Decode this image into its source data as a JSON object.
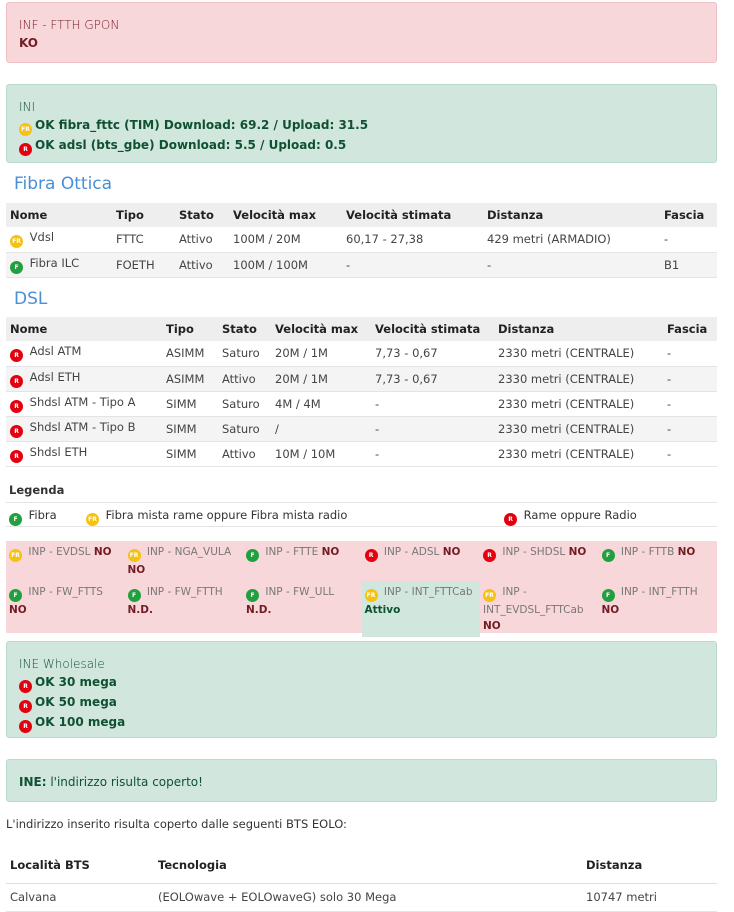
{
  "inf": {
    "title": "INF - FTTH GPON",
    "status": "KO"
  },
  "ini": {
    "title": "INI",
    "lines": [
      {
        "badge": "FR",
        "text": "OK fibra_fttc (TIM) Download: 69.2 / Upload: 31.5"
      },
      {
        "badge": "R",
        "text": "OK adsl (bts_gbe) Download: 5.5 / Upload: 0.5"
      }
    ]
  },
  "fibra": {
    "title": "Fibra Ottica",
    "headers": [
      "Nome",
      "Tipo",
      "Stato",
      "Velocità max",
      "Velocità stimata",
      "Distanza",
      "Fascia"
    ],
    "rows": [
      [
        "FR",
        "Vdsl",
        "FTTC",
        "Attivo",
        "100M / 20M",
        "60,17 - 27,38",
        "429 metri (ARMADIO)",
        "-"
      ],
      [
        "F",
        "Fibra ILC",
        "FOETH",
        "Attivo",
        "100M / 100M",
        "-",
        "-",
        "B1"
      ]
    ]
  },
  "dsl": {
    "title": "DSL",
    "headers": [
      "Nome",
      "Tipo",
      "Stato",
      "Velocità max",
      "Velocità stimata",
      "Distanza",
      "Fascia"
    ],
    "rows": [
      [
        "R",
        "Adsl ATM",
        "ASIMM",
        "Saturo",
        "20M / 1M",
        "7,73 - 0,67",
        "2330 metri (CENTRALE)",
        "-"
      ],
      [
        "R",
        "Adsl ETH",
        "ASIMM",
        "Attivo",
        "20M / 1M",
        "7,73 - 0,67",
        "2330 metri (CENTRALE)",
        "-"
      ],
      [
        "R",
        "Shdsl ATM - Tipo A",
        "SIMM",
        "Saturo",
        "4M / 4M",
        "-",
        "2330 metri (CENTRALE)",
        "-"
      ],
      [
        "R",
        "Shdsl ATM - Tipo B",
        "SIMM",
        "Saturo",
        "/",
        "-",
        "2330 metri (CENTRALE)",
        "-"
      ],
      [
        "R",
        "Shdsl ETH",
        "SIMM",
        "Attivo",
        "10M / 10M",
        "-",
        "2330 metri (CENTRALE)",
        "-"
      ]
    ]
  },
  "legend": {
    "title": "Legenda",
    "items": [
      {
        "badge": "F",
        "label": "Fibra"
      },
      {
        "badge": "FR",
        "label": "Fibra mista rame oppure Fibra mista radio"
      },
      {
        "badge": "R",
        "label": "Rame oppure Radio"
      }
    ]
  },
  "inp": [
    {
      "badge": "FR",
      "label": "INP - EVDSL",
      "value": "NO"
    },
    {
      "badge": "FR",
      "label": "INP - NGA_VULA",
      "value": "NO"
    },
    {
      "badge": "F",
      "label": "INP - FTTE",
      "value": "NO"
    },
    {
      "badge": "R",
      "label": "INP - ADSL",
      "value": "NO"
    },
    {
      "badge": "R",
      "label": "INP - SHDSL",
      "value": "NO"
    },
    {
      "badge": "F",
      "label": "INP - FTTB",
      "value": "NO"
    },
    {
      "badge": "F",
      "label": "INP - FW_FTTS",
      "value": "NO"
    },
    {
      "badge": "F",
      "label": "INP - FW_FTTH",
      "value": "N.D."
    },
    {
      "badge": "F",
      "label": "INP - FW_ULL",
      "value": "N.D."
    },
    {
      "badge": "FR",
      "label": "INP - INT_FTTCab",
      "value": "Attivo",
      "ok": true
    },
    {
      "badge": "FR",
      "label": "INP - INT_EVDSL_FTTCab",
      "value": "NO"
    },
    {
      "badge": "F",
      "label": "INP - INT_FTTH",
      "value": "NO"
    }
  ],
  "ine": {
    "title": "INE Wholesale",
    "lines": [
      {
        "badge": "R",
        "text": "OK 30 mega"
      },
      {
        "badge": "R",
        "text": "OK 50 mega"
      },
      {
        "badge": "R",
        "text": "OK 100 mega"
      }
    ]
  },
  "ine_note": {
    "label": "INE:",
    "text": " l'indirizzo risulta coperto!"
  },
  "bts": {
    "intro": "L'indirizzo inserito risulta coperto dalle seguenti BTS EOLO:",
    "headers": [
      "Località BTS",
      "Tecnologia",
      "Distanza"
    ],
    "rows": [
      [
        "Calvana",
        "(EOLOwave + EOLOwaveG) solo 30 Mega",
        "10747 metri"
      ]
    ]
  },
  "colors": {
    "red_bg": "#f8d7da",
    "green_bg": "#d1e7dd",
    "heading": "#4a8fd6",
    "FR": "#f7c10f",
    "R": "#e3000f",
    "F": "#21a040"
  }
}
